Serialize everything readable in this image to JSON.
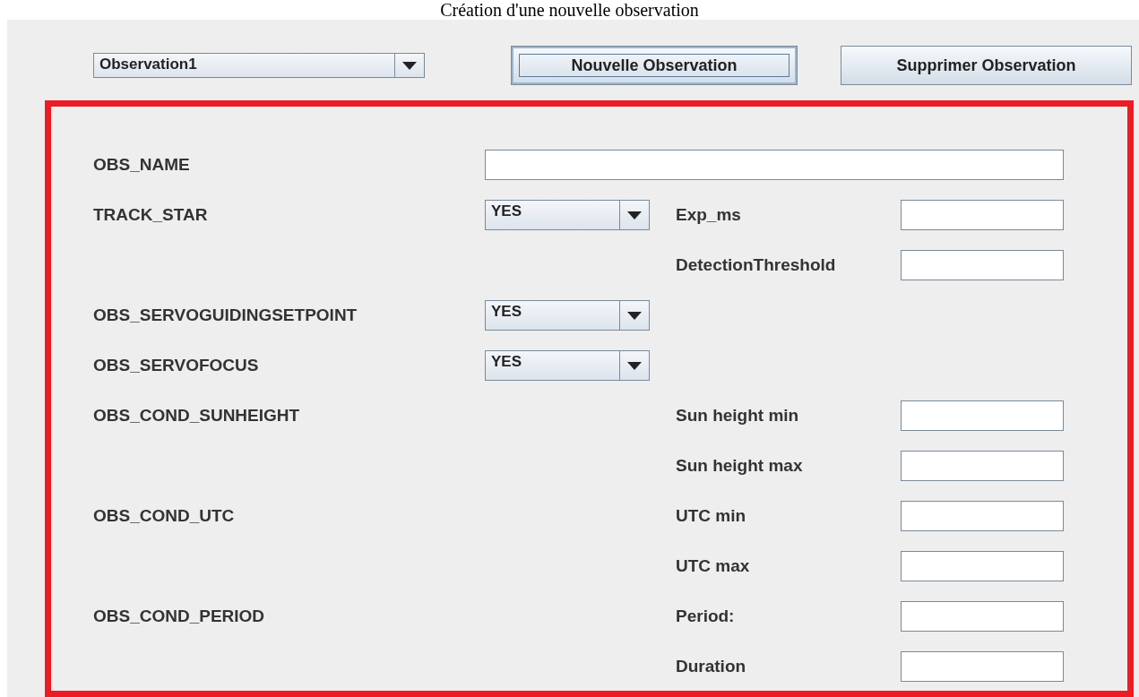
{
  "caption": "Création d'une nouvelle observation",
  "toolbar": {
    "observation_select": {
      "value": "Observation1"
    },
    "buttons": [
      {
        "label": "Nouvelle Observation",
        "focused": true
      },
      {
        "label": "Supprimer Observation",
        "focused": false
      }
    ]
  },
  "form_rows": [
    {
      "label": "OBS_NAME",
      "kind": "wide-field"
    },
    {
      "label": "TRACK_STAR",
      "kind": "select",
      "value": "YES",
      "sub_label": "Exp_ms"
    },
    {
      "kind": "sub",
      "sub_label": "DetectionThreshold"
    },
    {
      "label": "OBS_SERVOGUIDINGSETPOINT",
      "kind": "select",
      "value": "YES"
    },
    {
      "label": "OBS_SERVOFOCUS",
      "kind": "select",
      "value": "YES"
    },
    {
      "label": "OBS_COND_SUNHEIGHT",
      "kind": "sub",
      "sub_label": "Sun height min"
    },
    {
      "kind": "sub",
      "sub_label": "Sun height max"
    },
    {
      "label": "OBS_COND_UTC",
      "kind": "sub",
      "sub_label": "UTC min"
    },
    {
      "kind": "sub",
      "sub_label": "UTC max"
    },
    {
      "label": "OBS_COND_PERIOD",
      "kind": "sub",
      "sub_label": "Period:"
    },
    {
      "kind": "sub",
      "sub_label": "Duration"
    }
  ]
}
